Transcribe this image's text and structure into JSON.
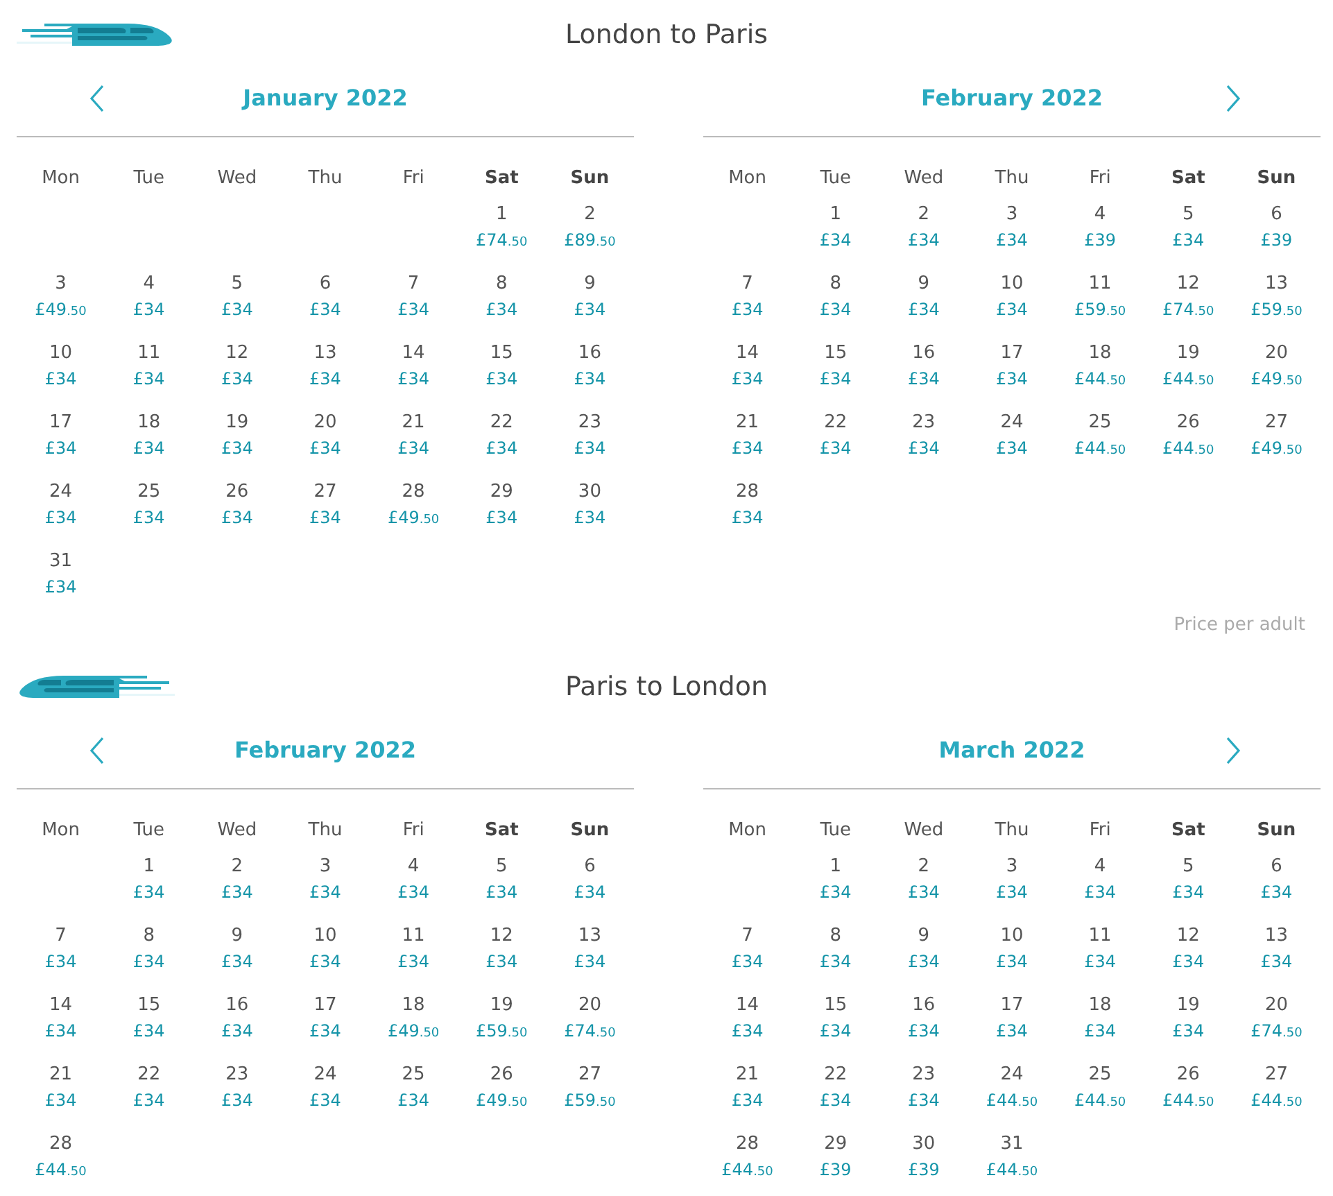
{
  "sections": [
    {
      "title": "London to Paris",
      "train_mirrored": false,
      "footer": "Price per adult",
      "months": [
        {
          "name": "January 2022",
          "prev_arrow": true,
          "weekdays": [
            {
              "label": "Mon",
              "weekend": false
            },
            {
              "label": "Tue",
              "weekend": false
            },
            {
              "label": "Wed",
              "weekend": false
            },
            {
              "label": "Thu",
              "weekend": false
            },
            {
              "label": "Fri",
              "weekend": false
            },
            {
              "label": "Sat",
              "weekend": true
            },
            {
              "label": "Sun",
              "weekend": true
            }
          ],
          "weeks": [
            [
              {
                "kind": "empty"
              },
              {
                "kind": "empty"
              },
              {
                "kind": "empty"
              },
              {
                "kind": "empty"
              },
              {
                "kind": "empty"
              },
              {
                "kind": "day",
                "d": "1",
                "p": "£74.50"
              },
              {
                "kind": "day",
                "d": "2",
                "p": "£89.50"
              }
            ],
            [
              {
                "kind": "day",
                "d": "3",
                "p": "£49.50"
              },
              {
                "kind": "day",
                "d": "4",
                "p": "£34"
              },
              {
                "kind": "day",
                "d": "5",
                "p": "£34"
              },
              {
                "kind": "day",
                "d": "6",
                "p": "£34"
              },
              {
                "kind": "day",
                "d": "7",
                "p": "£34"
              },
              {
                "kind": "day",
                "d": "8",
                "p": "£34"
              },
              {
                "kind": "day",
                "d": "9",
                "p": "£34"
              }
            ],
            [
              {
                "kind": "day",
                "d": "10",
                "p": "£34"
              },
              {
                "kind": "day",
                "d": "11",
                "p": "£34"
              },
              {
                "kind": "day",
                "d": "12",
                "p": "£34"
              },
              {
                "kind": "day",
                "d": "13",
                "p": "£34"
              },
              {
                "kind": "day",
                "d": "14",
                "p": "£34"
              },
              {
                "kind": "day",
                "d": "15",
                "p": "£34"
              },
              {
                "kind": "day",
                "d": "16",
                "p": "£34"
              }
            ],
            [
              {
                "kind": "day",
                "d": "17",
                "p": "£34"
              },
              {
                "kind": "day",
                "d": "18",
                "p": "£34"
              },
              {
                "kind": "day",
                "d": "19",
                "p": "£34"
              },
              {
                "kind": "day",
                "d": "20",
                "p": "£34"
              },
              {
                "kind": "day",
                "d": "21",
                "p": "£34"
              },
              {
                "kind": "day",
                "d": "22",
                "p": "£34"
              },
              {
                "kind": "day",
                "d": "23",
                "p": "£34"
              }
            ],
            [
              {
                "kind": "day",
                "d": "24",
                "p": "£34"
              },
              {
                "kind": "day",
                "d": "25",
                "p": "£34"
              },
              {
                "kind": "day",
                "d": "26",
                "p": "£34"
              },
              {
                "kind": "day",
                "d": "27",
                "p": "£34"
              },
              {
                "kind": "day",
                "d": "28",
                "p": "£49.50"
              },
              {
                "kind": "day",
                "d": "29",
                "p": "£34"
              },
              {
                "kind": "day",
                "d": "30",
                "p": "£34"
              }
            ],
            [
              {
                "kind": "day",
                "d": "31",
                "p": "£34"
              }
            ]
          ]
        },
        {
          "name": "February 2022",
          "next_arrow": true,
          "weekdays": [
            {
              "label": "Mon",
              "weekend": false
            },
            {
              "label": "Tue",
              "weekend": false
            },
            {
              "label": "Wed",
              "weekend": false
            },
            {
              "label": "Thu",
              "weekend": false
            },
            {
              "label": "Fri",
              "weekend": false
            },
            {
              "label": "Sat",
              "weekend": true
            },
            {
              "label": "Sun",
              "weekend": true
            }
          ],
          "weeks": [
            [
              {
                "kind": "empty"
              },
              {
                "kind": "day",
                "d": "1",
                "p": "£34"
              },
              {
                "kind": "day",
                "d": "2",
                "p": "£34"
              },
              {
                "kind": "day",
                "d": "3",
                "p": "£34"
              },
              {
                "kind": "day",
                "d": "4",
                "p": "£39"
              },
              {
                "kind": "day",
                "d": "5",
                "p": "£34"
              },
              {
                "kind": "day",
                "d": "6",
                "p": "£39"
              }
            ],
            [
              {
                "kind": "day",
                "d": "7",
                "p": "£34"
              },
              {
                "kind": "day",
                "d": "8",
                "p": "£34"
              },
              {
                "kind": "day",
                "d": "9",
                "p": "£34"
              },
              {
                "kind": "day",
                "d": "10",
                "p": "£34"
              },
              {
                "kind": "day",
                "d": "11",
                "p": "£59.50"
              },
              {
                "kind": "day",
                "d": "12",
                "p": "£74.50"
              },
              {
                "kind": "day",
                "d": "13",
                "p": "£59.50"
              }
            ],
            [
              {
                "kind": "day",
                "d": "14",
                "p": "£34"
              },
              {
                "kind": "day",
                "d": "15",
                "p": "£34"
              },
              {
                "kind": "day",
                "d": "16",
                "p": "£34"
              },
              {
                "kind": "day",
                "d": "17",
                "p": "£34"
              },
              {
                "kind": "day",
                "d": "18",
                "p": "£44.50"
              },
              {
                "kind": "day",
                "d": "19",
                "p": "£44.50"
              },
              {
                "kind": "day",
                "d": "20",
                "p": "£49.50"
              }
            ],
            [
              {
                "kind": "day",
                "d": "21",
                "p": "£34"
              },
              {
                "kind": "day",
                "d": "22",
                "p": "£34"
              },
              {
                "kind": "day",
                "d": "23",
                "p": "£34"
              },
              {
                "kind": "day",
                "d": "24",
                "p": "£34"
              },
              {
                "kind": "day",
                "d": "25",
                "p": "£44.50"
              },
              {
                "kind": "day",
                "d": "26",
                "p": "£44.50"
              },
              {
                "kind": "day",
                "d": "27",
                "p": "£49.50"
              }
            ],
            [
              {
                "kind": "day",
                "d": "28",
                "p": "£34"
              }
            ]
          ]
        }
      ]
    },
    {
      "title": "Paris to London",
      "train_mirrored": true,
      "months": [
        {
          "name": "February 2022",
          "prev_arrow": true,
          "weekdays": [
            {
              "label": "Mon",
              "weekend": false
            },
            {
              "label": "Tue",
              "weekend": false
            },
            {
              "label": "Wed",
              "weekend": false
            },
            {
              "label": "Thu",
              "weekend": false
            },
            {
              "label": "Fri",
              "weekend": false
            },
            {
              "label": "Sat",
              "weekend": true
            },
            {
              "label": "Sun",
              "weekend": true
            }
          ],
          "weeks": [
            [
              {
                "kind": "empty"
              },
              {
                "kind": "day",
                "d": "1",
                "p": "£34"
              },
              {
                "kind": "day",
                "d": "2",
                "p": "£34"
              },
              {
                "kind": "day",
                "d": "3",
                "p": "£34"
              },
              {
                "kind": "day",
                "d": "4",
                "p": "£34"
              },
              {
                "kind": "day",
                "d": "5",
                "p": "£34"
              },
              {
                "kind": "day",
                "d": "6",
                "p": "£34"
              }
            ],
            [
              {
                "kind": "day",
                "d": "7",
                "p": "£34"
              },
              {
                "kind": "day",
                "d": "8",
                "p": "£34"
              },
              {
                "kind": "day",
                "d": "9",
                "p": "£34"
              },
              {
                "kind": "day",
                "d": "10",
                "p": "£34"
              },
              {
                "kind": "day",
                "d": "11",
                "p": "£34"
              },
              {
                "kind": "day",
                "d": "12",
                "p": "£34"
              },
              {
                "kind": "day",
                "d": "13",
                "p": "£34"
              }
            ],
            [
              {
                "kind": "day",
                "d": "14",
                "p": "£34"
              },
              {
                "kind": "day",
                "d": "15",
                "p": "£34"
              },
              {
                "kind": "day",
                "d": "16",
                "p": "£34"
              },
              {
                "kind": "day",
                "d": "17",
                "p": "£34"
              },
              {
                "kind": "day",
                "d": "18",
                "p": "£49.50"
              },
              {
                "kind": "day",
                "d": "19",
                "p": "£59.50"
              },
              {
                "kind": "day",
                "d": "20",
                "p": "£74.50"
              }
            ],
            [
              {
                "kind": "day",
                "d": "21",
                "p": "£34"
              },
              {
                "kind": "day",
                "d": "22",
                "p": "£34"
              },
              {
                "kind": "day",
                "d": "23",
                "p": "£34"
              },
              {
                "kind": "day",
                "d": "24",
                "p": "£34"
              },
              {
                "kind": "day",
                "d": "25",
                "p": "£34"
              },
              {
                "kind": "day",
                "d": "26",
                "p": "£49.50"
              },
              {
                "kind": "day",
                "d": "27",
                "p": "£59.50"
              }
            ],
            [
              {
                "kind": "day",
                "d": "28",
                "p": "£44.50"
              }
            ]
          ]
        },
        {
          "name": "March 2022",
          "next_arrow": true,
          "weekdays": [
            {
              "label": "Mon",
              "weekend": false
            },
            {
              "label": "Tue",
              "weekend": false
            },
            {
              "label": "Wed",
              "weekend": false
            },
            {
              "label": "Thu",
              "weekend": false
            },
            {
              "label": "Fri",
              "weekend": false
            },
            {
              "label": "Sat",
              "weekend": true
            },
            {
              "label": "Sun",
              "weekend": true
            }
          ],
          "weeks": [
            [
              {
                "kind": "empty"
              },
              {
                "kind": "day",
                "d": "1",
                "p": "£34"
              },
              {
                "kind": "day",
                "d": "2",
                "p": "£34"
              },
              {
                "kind": "day",
                "d": "3",
                "p": "£34"
              },
              {
                "kind": "day",
                "d": "4",
                "p": "£34"
              },
              {
                "kind": "day",
                "d": "5",
                "p": "£34"
              },
              {
                "kind": "day",
                "d": "6",
                "p": "£34"
              }
            ],
            [
              {
                "kind": "day",
                "d": "7",
                "p": "£34"
              },
              {
                "kind": "day",
                "d": "8",
                "p": "£34"
              },
              {
                "kind": "day",
                "d": "9",
                "p": "£34"
              },
              {
                "kind": "day",
                "d": "10",
                "p": "£34"
              },
              {
                "kind": "day",
                "d": "11",
                "p": "£34"
              },
              {
                "kind": "day",
                "d": "12",
                "p": "£34"
              },
              {
                "kind": "day",
                "d": "13",
                "p": "£34"
              }
            ],
            [
              {
                "kind": "day",
                "d": "14",
                "p": "£34"
              },
              {
                "kind": "day",
                "d": "15",
                "p": "£34"
              },
              {
                "kind": "day",
                "d": "16",
                "p": "£34"
              },
              {
                "kind": "day",
                "d": "17",
                "p": "£34"
              },
              {
                "kind": "day",
                "d": "18",
                "p": "£34"
              },
              {
                "kind": "day",
                "d": "19",
                "p": "£34"
              },
              {
                "kind": "day",
                "d": "20",
                "p": "£74.50"
              }
            ],
            [
              {
                "kind": "day",
                "d": "21",
                "p": "£34"
              },
              {
                "kind": "day",
                "d": "22",
                "p": "£34"
              },
              {
                "kind": "day",
                "d": "23",
                "p": "£34"
              },
              {
                "kind": "day",
                "d": "24",
                "p": "£44.50"
              },
              {
                "kind": "day",
                "d": "25",
                "p": "£44.50"
              },
              {
                "kind": "day",
                "d": "26",
                "p": "£44.50"
              },
              {
                "kind": "day",
                "d": "27",
                "p": "£44.50"
              }
            ],
            [
              {
                "kind": "day",
                "d": "28",
                "p": "£44.50"
              },
              {
                "kind": "day",
                "d": "29",
                "p": "£39"
              },
              {
                "kind": "day",
                "d": "30",
                "p": "£39"
              },
              {
                "kind": "day",
                "d": "31",
                "p": "£44.50"
              }
            ]
          ]
        }
      ]
    }
  ]
}
